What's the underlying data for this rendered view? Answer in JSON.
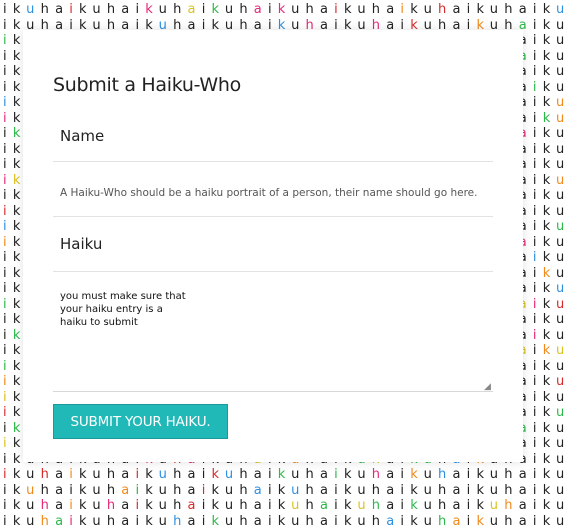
{
  "background": {
    "rows": [
      "ikuhaikuhaikuhaikuhaikuhaikuhaikuhaikuhaikuhaik",
      "ikuhaikuhaikuhaikuhaikuhaikuhaikuhaikuhaikuhaik",
      "ikuhaikuhaikuhaikuhaikuhaikuhaikuhaikuhaikuhaik",
      "ikuhaikuhaikuhaikuhaikuhaikuhaikuhaikuhaikuhaik",
      "ikuhaikuhaikuhaikuhaikuhaikuhaikuhaikuhaikuhaik",
      "ikuhaikuhaikuhaikuhaikuhaikuhaikuhaikuhaikuhaik",
      "ikuhaikuhaikuhaikuhaikuhaikuhaikuhaikuhaikuhaik",
      "ikuhaikuhaikuhaikuhaikuhaikuhaikuhaikuhaikuhaik",
      "ikuhaikuhaikuhaikuhaikuhaikuhaikuhaikuhaikuhaik",
      "ikuhaikuhaikuhaikuhaikuhaikuhaikuhaikuhaikuhaik",
      "ikuhaikuhaikuhaikuhaikuhaikuhaikuhaikuhaikuhaik",
      "ikuhaikuhaikuhaikuhaikuhaikuhaikuhaikuhaikuhaik",
      "ikuhaikuhaikuhaikuhaikuhaikuhaikuhaikuhaikuhaik",
      "ikuhaikuhaikuhaikuhaikuhaikuhaikuhaikuhaikuhaik",
      "ikuhaikuhaikuhaikuhaikuhaikuhaikuhaikuhaikuhaik",
      "ikuhaikuhaikuhaikuhaikuhaikuhaikuhaikuhaikuhaik",
      "ikuhaikuhaikuhaikuhaikuhaikuhaikuhaikuhaikuhaik",
      "ikuhaikuhaikuhaikuhaikuhaikuhaikuhaikuhaikuhaik",
      "ikuhaikuhaikuhaikuhaikuhaikuhaikuhaikuhaikuhaik",
      "ikuhaikuhaikuhaikuhaikuhaikuhaikuhaikuhaikuhaik",
      "ikuhaikuhaikuhaikuhaikuhaikuhaikuhaikuhaikuhaik",
      "ikuhaikuhaikuhaikuhaikuhaikuhaikuhaikuhaikuhaik",
      "ikuhaikuhaikuhaikuhaikuhaikuhaikuhaikuhaikuhaik",
      "ikuhaikuhaikuhaikuhaikuhaikuhaikuhaikuhaikuhaik",
      "ikuhaikuhaikuhaikuhaikuhaikuhaikuhaikuhaikuhaik",
      "ikuhaikuhaikuhaikuhaikuhaikuhaikuhaikuhaikuhaik",
      "ikuhaikuhaikuhaikuhaikuhaikuhaikuhaikuhaikuhaik",
      "ikuhaikuhaikuhaikuhaikuhaikuhaikuhaikuhaikuhaik",
      "ikuhaikuhaikuhaikuhaikuhaikuhaikuhaikuhaikuhaik",
      "ikuhaikuhaikuhaikuhaikuhaikuhaikuhaikuhaikuhaik",
      "ikuhaikuhaikuhaikuhaikuhaikuhaikuhaikuhaikuhaik",
      "ikuhaikuhaikuhaikuhaikuhaikuhaikuhaikuhaikuhaik",
      "ikuhaikuhaikuhaikuhaikuhaikuhaikuhaikuhaikuhaik",
      "ikuhaikuhaikuhaikuhaikuhaikuhaikuhaikuhaikuhaik"
    ],
    "accent_colors": [
      "#2db84a",
      "#2d8fe0",
      "#e3297a",
      "#d9c320",
      "#f08a1c",
      "#d62b2b"
    ]
  },
  "form": {
    "title": "Submit a Haiku-Who",
    "name_label": "Name",
    "name_hint": "A Haiku-Who should be a haiku portrait of a person, their name should go here.",
    "haiku_label": "Haiku",
    "haiku_value": "you must make sure that\nyour haiku entry is a\nhaiku to submit",
    "submit_label": "SUBMIT YOUR HAIKU.",
    "submit_color": "#21b8b8"
  }
}
